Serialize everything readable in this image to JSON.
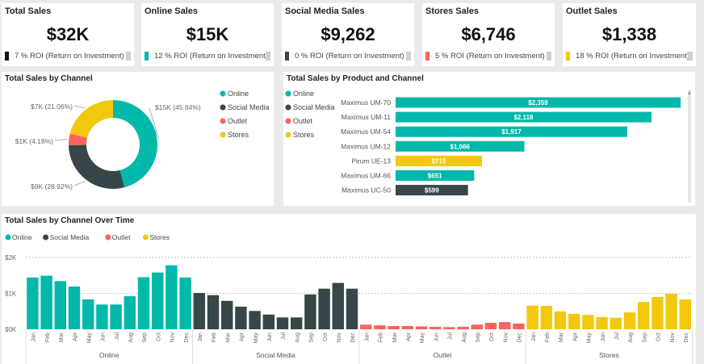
{
  "cards": [
    {
      "title": "Total Sales",
      "value": "$32K",
      "roi": "7 % ROI (Return on Investment)",
      "color": "#111111"
    },
    {
      "title": "Online Sales",
      "value": "$15K",
      "roi": "12 % ROI (Return on Investment)",
      "color": "#01b8aa"
    },
    {
      "title": "Social Media Sales",
      "value": "$9,262",
      "roi": "0 % ROI (Return on Investment)",
      "color": "#374649"
    },
    {
      "title": "Stores Sales",
      "value": "$6,746",
      "roi": "5 % ROI (Return on Investment)",
      "color": "#fd625e"
    },
    {
      "title": "Outlet Sales",
      "value": "$1,338",
      "roi": "18 % ROI (Return on Investment)",
      "color": "#f2c80f"
    }
  ],
  "colors": {
    "Online": "#01b8aa",
    "Social Media": "#374649",
    "Outlet": "#fd625e",
    "Stores": "#f2c80f"
  },
  "donut": {
    "title": "Total Sales by Channel",
    "chart_data": {
      "type": "pie",
      "slices": [
        {
          "name": "Online",
          "value": 45.84,
          "label": "$15K (45.84%)",
          "color": "#01b8aa"
        },
        {
          "name": "Social Media",
          "value": 28.92,
          "label": "$9K (28.92%)",
          "color": "#374649"
        },
        {
          "name": "Outlet",
          "value": 4.18,
          "label": "$1K (4.18%)",
          "color": "#fd625e"
        },
        {
          "name": "Stores",
          "value": 21.06,
          "label": "$7K (21.06%)",
          "color": "#f2c80f"
        }
      ],
      "legend": [
        "Online",
        "Social Media",
        "Outlet",
        "Stores"
      ]
    }
  },
  "product": {
    "title": "Total Sales by Product and Channel",
    "chart_data": {
      "type": "bar",
      "categories": [
        "Maximus UM-70",
        "Maximus UM-11",
        "Maximus UM-54",
        "Maximus UM-12",
        "Pirum UE-13",
        "Maximus UM-66",
        "Maximus UC-50"
      ],
      "values": [
        2359,
        2118,
        1917,
        1066,
        715,
        651,
        599
      ],
      "labels": [
        "$2,359",
        "$2,118",
        "$1,917",
        "$1,066",
        "$715",
        "$651",
        "$599"
      ],
      "channels": [
        "Online",
        "Online",
        "Online",
        "Online",
        "Stores",
        "Online",
        "Social Media"
      ],
      "legend": [
        "Online",
        "Social Media",
        "Outlet",
        "Stores"
      ]
    }
  },
  "time": {
    "title": "Total Sales by Channel Over Time",
    "chart_data": {
      "type": "bar",
      "months": [
        "Jan",
        "Feb",
        "Mar",
        "Apr",
        "May",
        "Jun",
        "Jul",
        "Aug",
        "Sep",
        "Oct",
        "Nov",
        "Dec"
      ],
      "yticks": [
        "$2K",
        "$1K",
        "$0K"
      ],
      "ylim": [
        0,
        2200
      ],
      "series": [
        {
          "name": "Online",
          "values": [
            1440,
            1490,
            1340,
            1190,
            830,
            690,
            690,
            920,
            1450,
            1580,
            1780,
            1440
          ]
        },
        {
          "name": "Social Media",
          "values": [
            1010,
            950,
            790,
            630,
            510,
            410,
            330,
            330,
            970,
            1130,
            1290,
            1130
          ]
        },
        {
          "name": "Outlet",
          "values": [
            130,
            110,
            90,
            90,
            80,
            70,
            60,
            70,
            130,
            180,
            200,
            160
          ]
        },
        {
          "name": "Stores",
          "values": [
            660,
            650,
            500,
            430,
            400,
            340,
            320,
            470,
            760,
            900,
            990,
            830
          ]
        }
      ],
      "legend": [
        "Online",
        "Social Media",
        "Outlet",
        "Stores"
      ]
    }
  }
}
